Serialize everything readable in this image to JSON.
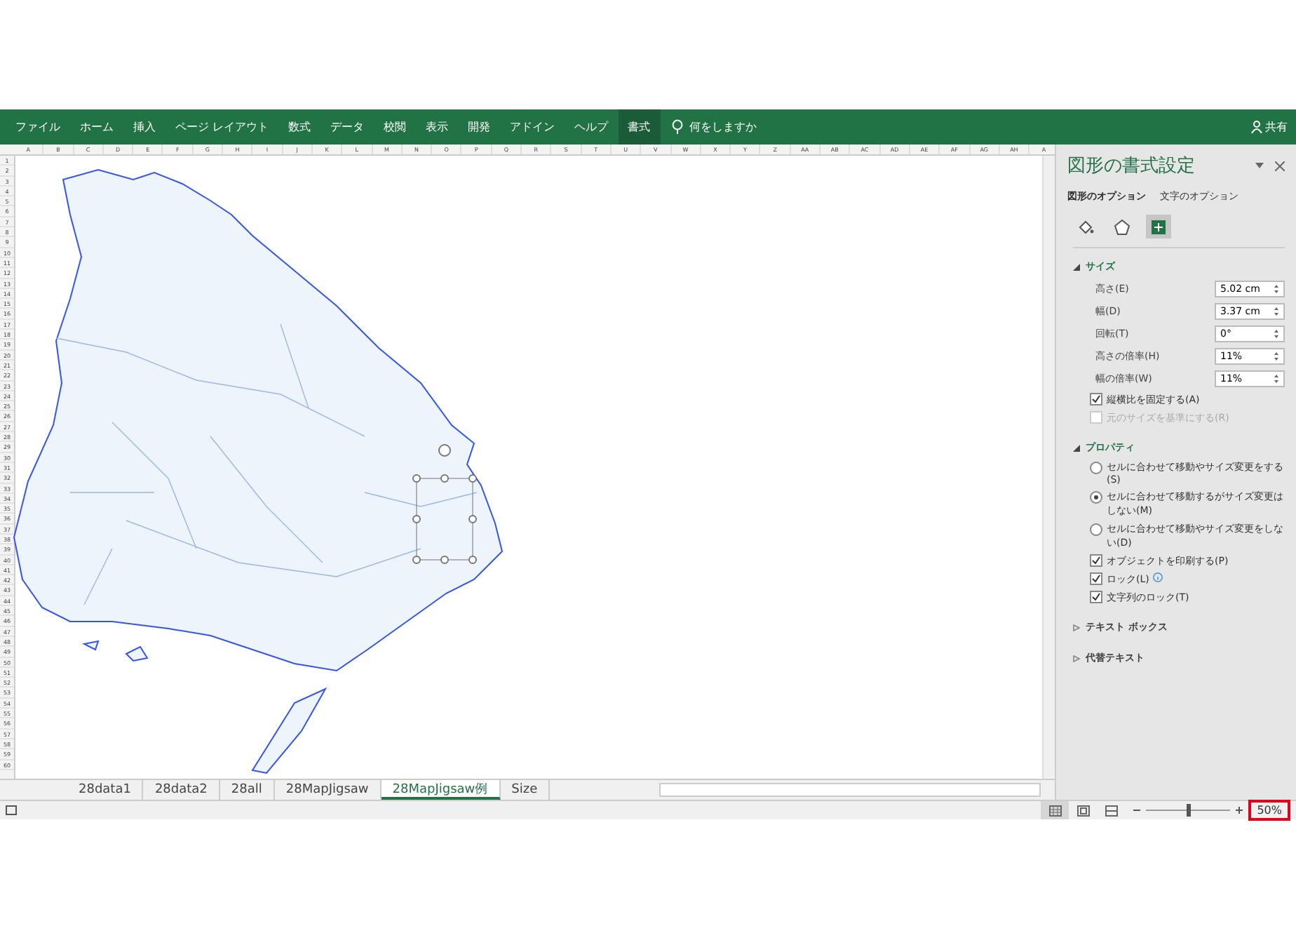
{
  "ribbon": {
    "tabs": [
      {
        "label": "ファイル",
        "selected": false
      },
      {
        "label": "ホーム",
        "selected": false
      },
      {
        "label": "挿入",
        "selected": false
      },
      {
        "label": "ページ レイアウト",
        "selected": false
      },
      {
        "label": "数式",
        "selected": false
      },
      {
        "label": "データ",
        "selected": false
      },
      {
        "label": "校閲",
        "selected": false
      },
      {
        "label": "表示",
        "selected": false
      },
      {
        "label": "開発",
        "selected": false
      },
      {
        "label": "アドイン",
        "selected": false
      },
      {
        "label": "ヘルプ",
        "selected": false
      },
      {
        "label": "書式",
        "selected": true
      }
    ],
    "tell_me": "何をしますか",
    "share": "共有"
  },
  "sheet": {
    "columns": [
      "A",
      "B",
      "C",
      "D",
      "E",
      "F",
      "G",
      "H",
      "I",
      "J",
      "K",
      "L",
      "M",
      "N",
      "O",
      "P",
      "Q",
      "R",
      "S",
      "T",
      "U",
      "V",
      "W",
      "X",
      "Y",
      "Z",
      "AA",
      "AB",
      "AC",
      "AD",
      "AE",
      "AF",
      "AG",
      "AH",
      "A"
    ],
    "rows": [
      "1",
      "2",
      "3",
      "4",
      "5",
      "6",
      "7",
      "8",
      "9",
      "10",
      "11",
      "12",
      "13",
      "14",
      "15",
      "16",
      "17",
      "18",
      "19",
      "20",
      "21",
      "22",
      "23",
      "24",
      "25",
      "26",
      "27",
      "28",
      "29",
      "30",
      "31",
      "32",
      "33",
      "34",
      "35",
      "36",
      "37",
      "38",
      "39",
      "40",
      "41",
      "42",
      "43",
      "44",
      "45",
      "46",
      "47",
      "48",
      "49",
      "50",
      "51",
      "52",
      "53",
      "54",
      "55",
      "56",
      "57",
      "58",
      "59",
      "60"
    ]
  },
  "sheet_tabs": [
    {
      "label": "28data1",
      "selected": false
    },
    {
      "label": "28data2",
      "selected": false
    },
    {
      "label": "28all",
      "selected": false
    },
    {
      "label": "28MapJigsaw",
      "selected": false
    },
    {
      "label": "28MapJigsaw例",
      "selected": true
    },
    {
      "label": "Size",
      "selected": false
    }
  ],
  "status_bar": {
    "views": [
      {
        "kind": "normal",
        "selected": true
      },
      {
        "kind": "layout",
        "selected": false
      },
      {
        "kind": "pagebreak",
        "selected": false
      }
    ],
    "zoom": {
      "level": 0.5
    },
    "zoom_text": "50%"
  },
  "pane": {
    "title": "図形の書式設定",
    "tabs": [
      {
        "label": "図形のオプション",
        "selected": true
      },
      {
        "label": "文字のオプション",
        "selected": false
      }
    ],
    "icon_tabs": [
      {
        "kind": "fill",
        "selected": false
      },
      {
        "kind": "shape",
        "selected": false
      },
      {
        "kind": "size",
        "selected": true
      }
    ],
    "sections": [
      {
        "title": "サイズ",
        "expanded": true,
        "fields": [
          {
            "label": "高さ(E)",
            "value": "5.02 cm"
          },
          {
            "label": "幅(D)",
            "value": "3.37 cm"
          },
          {
            "label": "回転(T)",
            "value": "0°"
          },
          {
            "label": "高さの倍率(H)",
            "value": "11%"
          },
          {
            "label": "幅の倍率(W)",
            "value": "11%"
          }
        ],
        "checkboxes": [
          {
            "label": "縦横比を固定する(A)",
            "checked": true,
            "disabled": false
          },
          {
            "label": "元のサイズを基準にする(R)",
            "checked": false,
            "disabled": true
          }
        ]
      },
      {
        "title": "プロパティ",
        "expanded": true,
        "radios": [
          {
            "label": "セルに合わせて移動やサイズ変更をする(S)",
            "selected": false
          },
          {
            "label": "セルに合わせて移動するがサイズ変更はしない(M)",
            "selected": true
          },
          {
            "label": "セルに合わせて移動やサイズ変更をしない(D)",
            "selected": false
          }
        ],
        "checkboxes": [
          {
            "label": "オブジェクトを印刷する(P)",
            "checked": true,
            "disabled": false
          },
          {
            "label": "ロック(L)",
            "checked": true,
            "disabled": false,
            "info": true
          },
          {
            "label": "文字列のロック(T)",
            "checked": true,
            "disabled": false
          }
        ]
      },
      {
        "title": "テキスト ボックス",
        "expanded": false
      },
      {
        "title": "代替テキスト",
        "expanded": false
      }
    ]
  }
}
